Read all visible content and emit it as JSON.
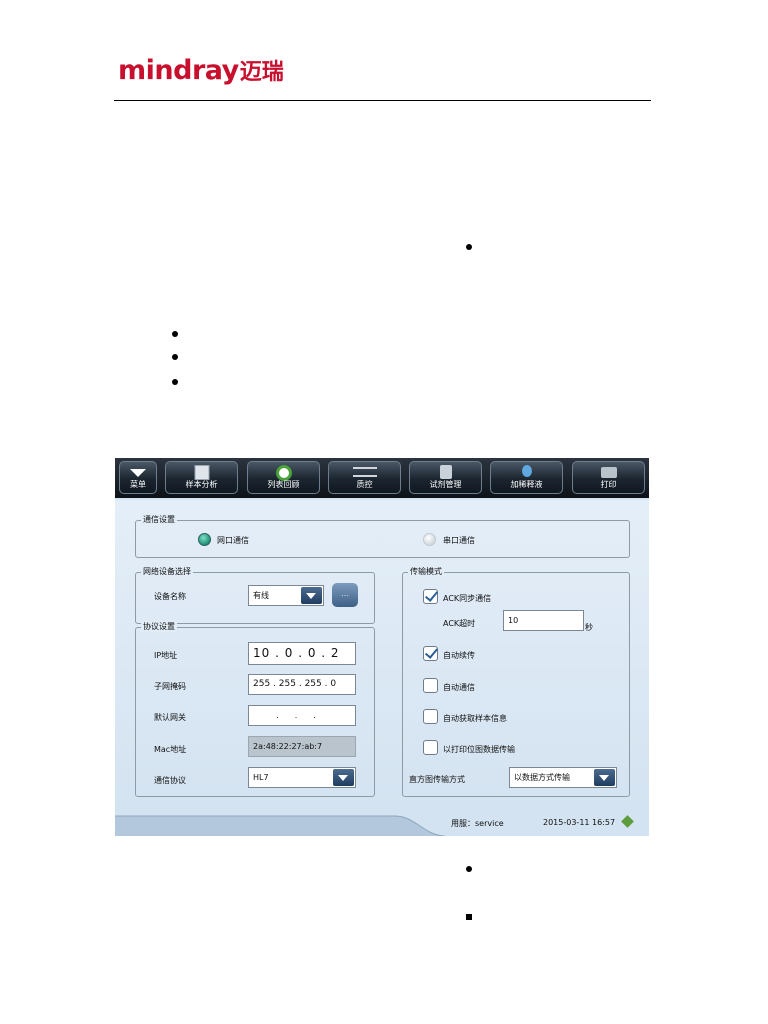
{
  "brand": {
    "name_en": "mindray",
    "name_cn": "迈瑞"
  },
  "toolbar": {
    "items": [
      {
        "label": "菜单",
        "icon": "menu-arrow-icon"
      },
      {
        "label": "样本分析",
        "icon": "sample-analysis-icon"
      },
      {
        "label": "列表回顾",
        "icon": "list-review-icon"
      },
      {
        "label": "质控",
        "icon": "balance-scale-icon"
      },
      {
        "label": "试剂管理",
        "icon": "reagent-icon"
      },
      {
        "label": "加稀释液",
        "icon": "diluent-drop-icon"
      },
      {
        "label": "打印",
        "icon": "printer-icon"
      }
    ]
  },
  "comm": {
    "legend": "通信设置",
    "network": {
      "label": "网口通信",
      "selected": true
    },
    "serial": {
      "label": "串口通信",
      "selected": false
    }
  },
  "netdev": {
    "legend": "网络设备选择",
    "device_label": "设备名称",
    "device_value": "有线",
    "more_button": "…"
  },
  "protocol": {
    "legend": "协议设置",
    "ip_label": "IP地址",
    "ip": [
      "10",
      "0",
      "0",
      "2"
    ],
    "mask_label": "子网掩码",
    "mask": [
      "255",
      "255",
      "255",
      "0"
    ],
    "gateway_label": "默认网关",
    "mac_label": "Mac地址",
    "mac_value": "2a:48:22:27:ab:7",
    "proto_label": "通信协议",
    "proto_value": "HL7"
  },
  "transfer": {
    "legend": "传输模式",
    "ack_sync": {
      "label": "ACK同步通信",
      "checked": true
    },
    "ack_timeout_label": "ACK超时",
    "ack_timeout_value": "10",
    "ack_timeout_unit": "秒",
    "auto_resend": {
      "label": "自动续传",
      "checked": true
    },
    "auto_comm": {
      "label": "自动通信",
      "checked": false
    },
    "auto_fetch": {
      "label": "自动获取样本信息",
      "checked": false
    },
    "bitmap_print": {
      "label": "以打印位图数据传输",
      "checked": false
    },
    "histogram_label": "直方图传输方式",
    "histogram_value": "以数据方式传输"
  },
  "status": {
    "user": "用服：service",
    "datetime": "2015-03-11 16:57"
  },
  "colors": {
    "brand": "#c8102e",
    "toolbar": "#1a222b",
    "accent": "#2a5a8a"
  }
}
